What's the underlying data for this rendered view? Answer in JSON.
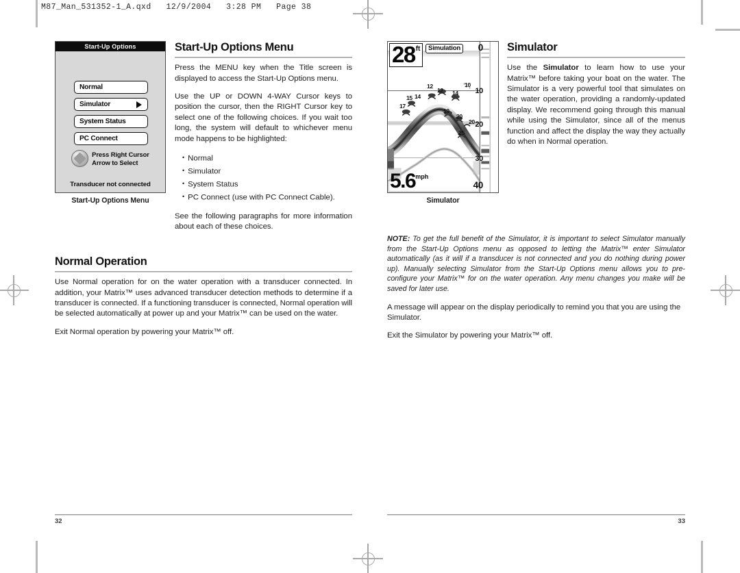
{
  "film_header": "M87_Man_531352-1_A.qxd   12/9/2004   3:28 PM   Page 38",
  "left_page": {
    "figure": {
      "screen_title": "Start-Up Options",
      "menu_items": [
        {
          "label": "Normal",
          "has_arrow": false
        },
        {
          "label": "Simulator",
          "has_arrow": true
        },
        {
          "label": "System Status",
          "has_arrow": false
        },
        {
          "label": "PC Connect",
          "has_arrow": false
        }
      ],
      "prompt_line1": "Press Right Cursor",
      "prompt_line2": "Arrow to Select",
      "status_text": "Transducer not connected",
      "caption": "Start-Up Options Menu"
    },
    "section1": {
      "heading": "Start-Up Options Menu",
      "paragraph1": "Press the MENU key when the Title screen is displayed to access the Start-Up Options menu.",
      "paragraph2": "Use the UP or DOWN 4-WAY Cursor keys to position the cursor, then the RIGHT Cursor key to select one of the following choices. If you wait too long, the system will default to whichever menu mode happens to be highlighted:",
      "choices": [
        "Normal",
        "Simulator",
        "System Status",
        "PC Connect (use with PC Connect Cable)."
      ],
      "paragraph3": "See the following paragraphs for more information about each of these choices."
    },
    "section2": {
      "heading": "Normal Operation",
      "paragraph1": "Use Normal operation for on the water operation with a transducer connected. In addition, your Matrix™ uses advanced transducer detection methods to determine if a transducer is connected. If a functioning transducer is connected, Normal operation will be selected automatically at power up and your Matrix™ can be used on the water.",
      "paragraph2": "Exit Normal operation by powering your Matrix™ off."
    },
    "folio": "32"
  },
  "right_page": {
    "figure": {
      "depth_value": "28",
      "depth_unit": "ft",
      "simulation_badge": "Simulation",
      "speed_value": "5.6",
      "speed_unit": "mph",
      "depth_scale": [
        "0",
        "10",
        "20",
        "30",
        "40"
      ],
      "fish_labels": [
        "12",
        "12",
        "10",
        "15",
        "14",
        "17",
        "14",
        "19",
        "20",
        "20",
        "25"
      ],
      "caption": "Simulator"
    },
    "section1": {
      "heading": "Simulator",
      "paragraph1_lead": "Use the ",
      "paragraph1_bold": "Simulator",
      "paragraph1_rest": " to learn how to use your Matrix™ before taking your boat on the water. The Simulator is a very powerful tool that simulates on the water operation, providing a randomly-updated display. We recommend going through this manual while using the Simulator, since all of the menus function and affect the display the way they actually do when in Normal operation."
    },
    "note": {
      "label": "NOTE:",
      "text": " To get the full benefit of the Simulator, it is important to select Simulator manually from the Start-Up Options menu as opposed to letting the Matrix™ enter Simulator automatically (as it will if a transducer is not connected and you do nothing during power up). Manually selecting Simulator from the Start-Up Options menu allows you to pre-configure your Matrix™ for on the water operation. Any menu changes you make will be saved for later use."
    },
    "paragraph2": "A message will appear on the display periodically to remind you that you are using the Simulator.",
    "paragraph3": "Exit the Simulator by powering your Matrix™ off.",
    "folio": "33"
  }
}
